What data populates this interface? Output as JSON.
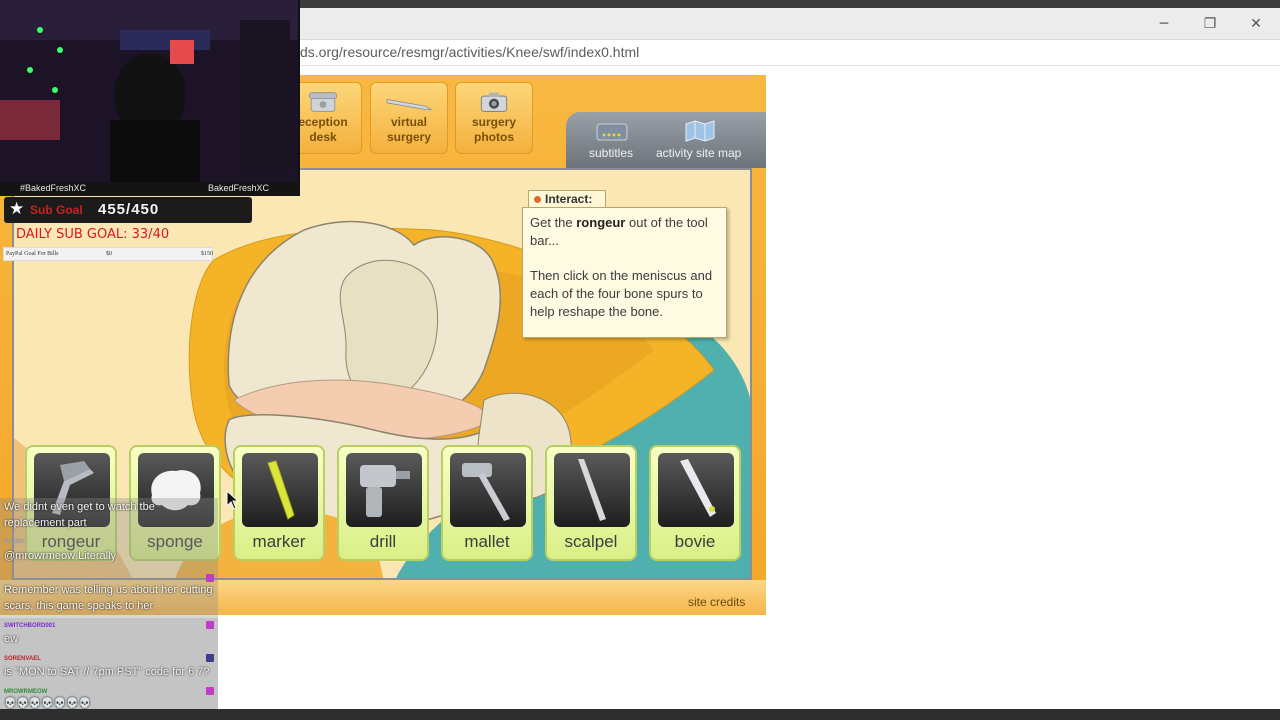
{
  "browser": {
    "url": "ds.org/resource/resmgr/activities/Knee/swf/index0.html",
    "minimize": "─",
    "restore": "❐",
    "close": "✕"
  },
  "game": {
    "nav": [
      {
        "label": "eception\ndesk",
        "icon": "telephone-icon"
      },
      {
        "label": "virtual\nsurgery",
        "icon": "scalpel-icon"
      },
      {
        "label": "surgery\nphotos",
        "icon": "camera-icon"
      }
    ],
    "tabs": {
      "subtitles": "subtitles",
      "site_map": "activity site map"
    },
    "interact": {
      "title": "Interact:",
      "line1_pre": "Get the ",
      "line1_bold": "rongeur",
      "line1_post": " out of the tool bar...",
      "line2": "Then click on the meniscus and each of the four bone spurs to help reshape the bone."
    },
    "tools": [
      "rongeur",
      "sponge",
      "marker",
      "drill",
      "mallet",
      "scalpel",
      "bovie"
    ],
    "credits": "site credits"
  },
  "overlay": {
    "handle_left": "#BakedFreshXC",
    "handle_right": "BakedFreshXC",
    "sub_goal_label": "Sub Goal",
    "sub_goal_value": "455/450",
    "daily_goal": "DAILY SUB GOAL: 33/40",
    "paypal": {
      "label": "PayPal Goal For Bills",
      "start": "$0",
      "end": "$150"
    },
    "chat": [
      {
        "user": "",
        "text": "We didnt even get to watch tbe replacement part"
      },
      {
        "user": "MADDI",
        "text": "@mrowrmeow Literally"
      },
      {
        "user": "",
        "text": "Remember       was telling us about her cutting scars, this game speaks to her"
      },
      {
        "user": "SWITCHBORD001",
        "text": "ew"
      },
      {
        "user": "SORENVAEL",
        "text": "is \"MON to SAT // 7pm PST\" code for 6 7?"
      },
      {
        "user": "MROWRMEOW",
        "text": "💀💀💀💀💀💀💀"
      }
    ]
  },
  "colors": {
    "accent_orange": "#f4a628",
    "tool_green": "#d9ef86",
    "chat_purple": "#c03cc9"
  }
}
